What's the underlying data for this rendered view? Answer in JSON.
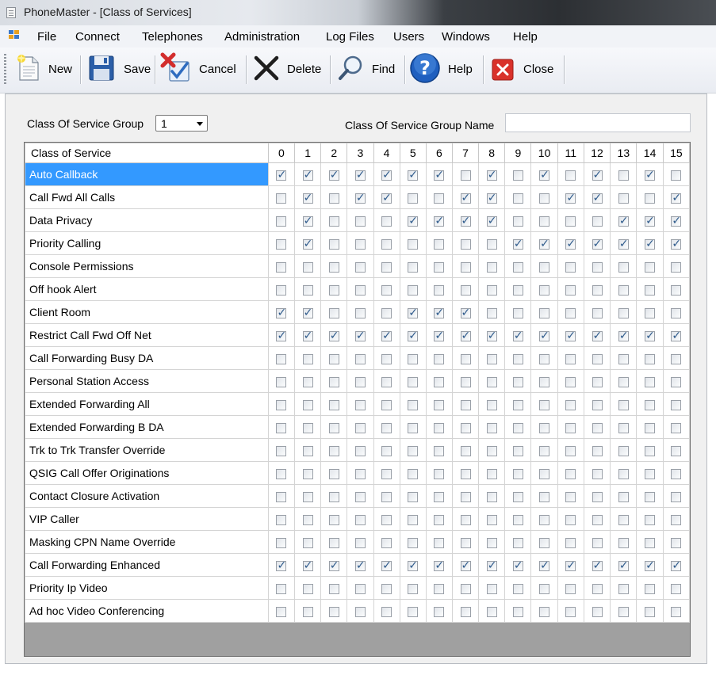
{
  "window": {
    "title": "PhoneMaster - [Class of Services]"
  },
  "menu": [
    "File",
    "Connect",
    "Telephones",
    "Administration",
    "Log Files",
    "Users",
    "Windows",
    "Help"
  ],
  "toolbar": [
    {
      "label": "New",
      "icon": "new-document-icon"
    },
    {
      "label": "Save",
      "icon": "floppy-disk-icon"
    },
    {
      "label": "Cancel",
      "icon": "cancel-icon"
    },
    {
      "label": "Delete",
      "icon": "delete-x-icon"
    },
    {
      "label": "Find",
      "icon": "magnifier-icon"
    },
    {
      "label": "Help",
      "icon": "help-icon"
    },
    {
      "label": "Close",
      "icon": "close-icon"
    }
  ],
  "form": {
    "group_label": "Class Of Service Group",
    "group_value": "1",
    "group_name_label": "Class Of Service Group Name",
    "group_name_value": ""
  },
  "grid": {
    "name_header": "Class of Service",
    "columns": [
      "0",
      "1",
      "2",
      "3",
      "4",
      "5",
      "6",
      "7",
      "8",
      "9",
      "10",
      "11",
      "12",
      "13",
      "14",
      "15"
    ],
    "selected_row": 0,
    "rows": [
      {
        "name": "Auto Callback",
        "checks": [
          1,
          1,
          1,
          1,
          1,
          1,
          1,
          0,
          1,
          0,
          1,
          0,
          1,
          0,
          1,
          0
        ]
      },
      {
        "name": "Call Fwd All Calls",
        "checks": [
          0,
          1,
          0,
          1,
          1,
          0,
          0,
          1,
          1,
          0,
          0,
          1,
          1,
          0,
          0,
          1
        ]
      },
      {
        "name": "Data Privacy",
        "checks": [
          0,
          1,
          0,
          0,
          0,
          1,
          1,
          1,
          1,
          0,
          0,
          0,
          0,
          1,
          1,
          1
        ]
      },
      {
        "name": "Priority Calling",
        "checks": [
          0,
          1,
          0,
          0,
          0,
          0,
          0,
          0,
          0,
          1,
          1,
          1,
          1,
          1,
          1,
          1
        ]
      },
      {
        "name": "Console Permissions",
        "checks": [
          0,
          0,
          0,
          0,
          0,
          0,
          0,
          0,
          0,
          0,
          0,
          0,
          0,
          0,
          0,
          0
        ]
      },
      {
        "name": "Off hook Alert",
        "checks": [
          0,
          0,
          0,
          0,
          0,
          0,
          0,
          0,
          0,
          0,
          0,
          0,
          0,
          0,
          0,
          0
        ]
      },
      {
        "name": "Client Room",
        "checks": [
          1,
          1,
          0,
          0,
          0,
          1,
          1,
          1,
          0,
          0,
          0,
          0,
          0,
          0,
          0,
          0
        ]
      },
      {
        "name": "Restrict Call Fwd Off Net",
        "checks": [
          1,
          1,
          1,
          1,
          1,
          1,
          1,
          1,
          1,
          1,
          1,
          1,
          1,
          1,
          1,
          1
        ]
      },
      {
        "name": "Call Forwarding Busy DA",
        "checks": [
          0,
          0,
          0,
          0,
          0,
          0,
          0,
          0,
          0,
          0,
          0,
          0,
          0,
          0,
          0,
          0
        ]
      },
      {
        "name": "Personal Station Access",
        "checks": [
          0,
          0,
          0,
          0,
          0,
          0,
          0,
          0,
          0,
          0,
          0,
          0,
          0,
          0,
          0,
          0
        ]
      },
      {
        "name": "Extended Forwarding All",
        "checks": [
          0,
          0,
          0,
          0,
          0,
          0,
          0,
          0,
          0,
          0,
          0,
          0,
          0,
          0,
          0,
          0
        ]
      },
      {
        "name": "Extended Forwarding B DA",
        "checks": [
          0,
          0,
          0,
          0,
          0,
          0,
          0,
          0,
          0,
          0,
          0,
          0,
          0,
          0,
          0,
          0
        ]
      },
      {
        "name": "Trk to Trk Transfer Override",
        "checks": [
          0,
          0,
          0,
          0,
          0,
          0,
          0,
          0,
          0,
          0,
          0,
          0,
          0,
          0,
          0,
          0
        ]
      },
      {
        "name": "QSIG Call Offer Originations",
        "checks": [
          0,
          0,
          0,
          0,
          0,
          0,
          0,
          0,
          0,
          0,
          0,
          0,
          0,
          0,
          0,
          0
        ]
      },
      {
        "name": "Contact Closure Activation",
        "checks": [
          0,
          0,
          0,
          0,
          0,
          0,
          0,
          0,
          0,
          0,
          0,
          0,
          0,
          0,
          0,
          0
        ]
      },
      {
        "name": "VIP Caller",
        "checks": [
          0,
          0,
          0,
          0,
          0,
          0,
          0,
          0,
          0,
          0,
          0,
          0,
          0,
          0,
          0,
          0
        ]
      },
      {
        "name": "Masking CPN Name Override",
        "checks": [
          0,
          0,
          0,
          0,
          0,
          0,
          0,
          0,
          0,
          0,
          0,
          0,
          0,
          0,
          0,
          0
        ]
      },
      {
        "name": "Call Forwarding Enhanced",
        "checks": [
          1,
          1,
          1,
          1,
          1,
          1,
          1,
          1,
          1,
          1,
          1,
          1,
          1,
          1,
          1,
          1
        ]
      },
      {
        "name": "Priority Ip Video",
        "checks": [
          0,
          0,
          0,
          0,
          0,
          0,
          0,
          0,
          0,
          0,
          0,
          0,
          0,
          0,
          0,
          0
        ]
      },
      {
        "name": "Ad hoc Video Conferencing",
        "checks": [
          0,
          0,
          0,
          0,
          0,
          0,
          0,
          0,
          0,
          0,
          0,
          0,
          0,
          0,
          0,
          0
        ]
      }
    ]
  },
  "colors": {
    "selection": "#3399ff",
    "grid_empty": "#a0a0a0"
  }
}
